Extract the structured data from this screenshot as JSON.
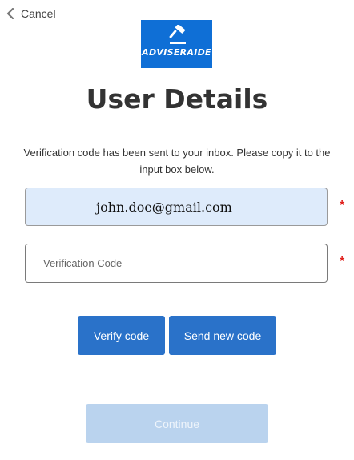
{
  "header": {
    "cancel_label": "Cancel",
    "cancel_icon": "chevron-left-icon"
  },
  "logo": {
    "text": "ADVISERAIDE",
    "icon": "gavel-icon",
    "background_color": "#0f6fd6"
  },
  "page": {
    "title": "User Details",
    "intro": "Verification code has been sent to your inbox. Please copy it to the input box below."
  },
  "form": {
    "email_value": "john.doe@gmail.com",
    "email_required_mark": "*",
    "code_placeholder": "Verification Code",
    "code_value": "",
    "code_required_mark": "*"
  },
  "actions": {
    "verify_label": "Verify code",
    "send_new_label": "Send new code",
    "continue_label": "Continue",
    "continue_disabled": true,
    "primary_color": "#2a72c9",
    "disabled_color": "#bad3ee",
    "required_color": "#e0201c"
  }
}
